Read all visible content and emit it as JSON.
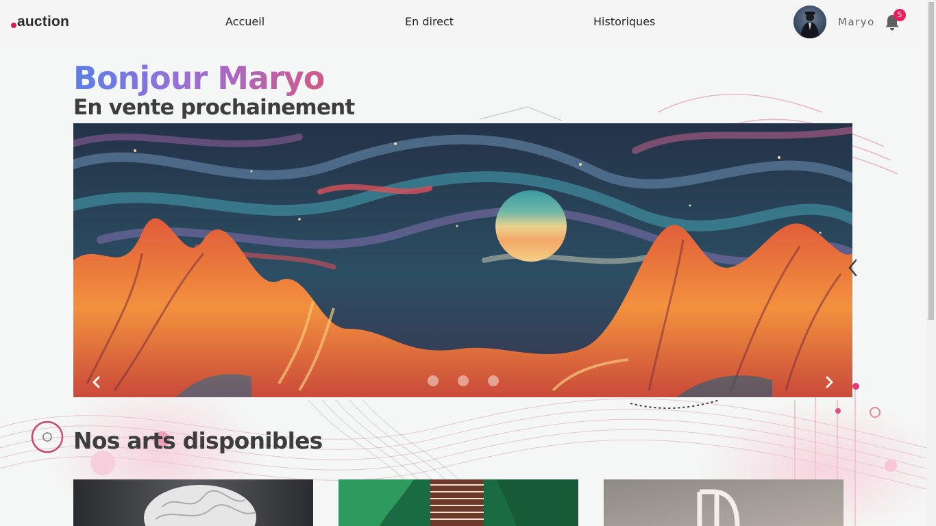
{
  "brand": {
    "logo_text": "auction",
    "accent": "#d91c5c"
  },
  "nav": {
    "items": [
      {
        "label": "Accueil"
      },
      {
        "label": "En direct"
      },
      {
        "label": "Historiques"
      }
    ]
  },
  "user": {
    "name": "Maryo",
    "notifications_count": "5"
  },
  "hero": {
    "greeting": "Bonjour Maryo",
    "subtitle": "En vente prochainement",
    "gradient_colors": [
      "#5b7fe8",
      "#9a6fd6",
      "#d05a8a"
    ]
  },
  "carousel": {
    "slide_count": 3,
    "active_index": 0,
    "prev_icon": "chevron-left-icon",
    "next_icon": "chevron-right-icon"
  },
  "arts": {
    "title": "Nos arts disponibles",
    "cards": [
      {
        "name": "sculpture-artwork"
      },
      {
        "name": "green-abstract-artwork"
      },
      {
        "name": "monogram-artwork"
      }
    ]
  },
  "icons": {
    "notification": "bell-icon",
    "profile": "avatar"
  }
}
